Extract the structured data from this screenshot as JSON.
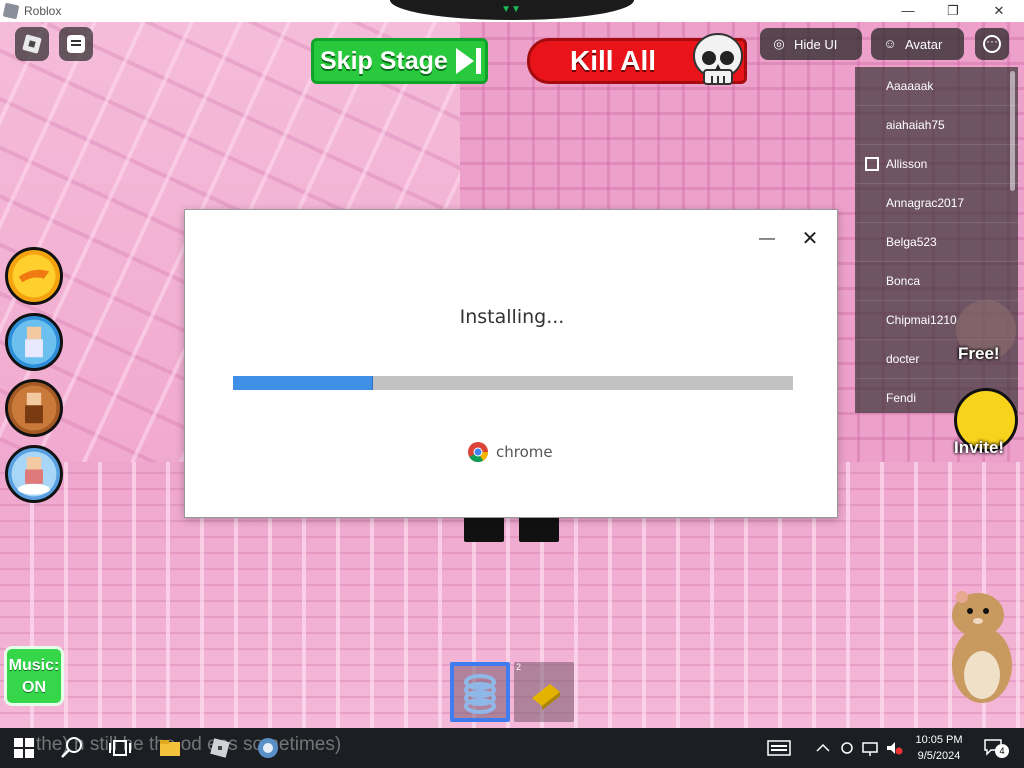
{
  "window": {
    "title": "Roblox",
    "minimize": "—",
    "maximize": "❐",
    "close": "✕"
  },
  "game_ui": {
    "skip_stage_label": "Skip Stage",
    "kill_all_label": "Kill All",
    "hide_ui_label": "Hide UI",
    "avatar_label": "Avatar",
    "more_label": "···",
    "music_label_line1": "Music:",
    "music_label_line2": "ON",
    "free_label": "Free!",
    "invite_label": "Invite!"
  },
  "player_list": {
    "players": [
      {
        "name": "Aaaaaak",
        "premium": false
      },
      {
        "name": "aiahaiah75",
        "premium": false
      },
      {
        "name": "Allisson",
        "premium": true
      },
      {
        "name": "Annagrac2017",
        "premium": false
      },
      {
        "name": "Belga523",
        "premium": false
      },
      {
        "name": "Bonca",
        "premium": false
      },
      {
        "name": "Chipmai1210",
        "premium": false
      },
      {
        "name": "docter",
        "premium": false
      },
      {
        "name": "Fendi",
        "premium": false
      }
    ]
  },
  "installer": {
    "status": "Installing...",
    "progress_fraction": 0.25,
    "brand": "chrome",
    "minimize": "—",
    "close": "✕"
  },
  "hotbar": {
    "slots": [
      {
        "num": "",
        "item": "spring-coil",
        "selected": true
      },
      {
        "num": "2",
        "item": "gold-bar",
        "selected": false
      }
    ]
  },
  "taskbar": {
    "overlay_text": "the) n  still he  the  od  eps sometimes)",
    "time": "10:05 PM",
    "date": "9/5/2024",
    "notifications": "4"
  },
  "colors": {
    "accent_blue": "#3f8fe6",
    "skip_green": "#28c93c",
    "kill_red": "#e8141a",
    "music_green": "#36d64b",
    "invite_yellow": "#f7d31c"
  }
}
